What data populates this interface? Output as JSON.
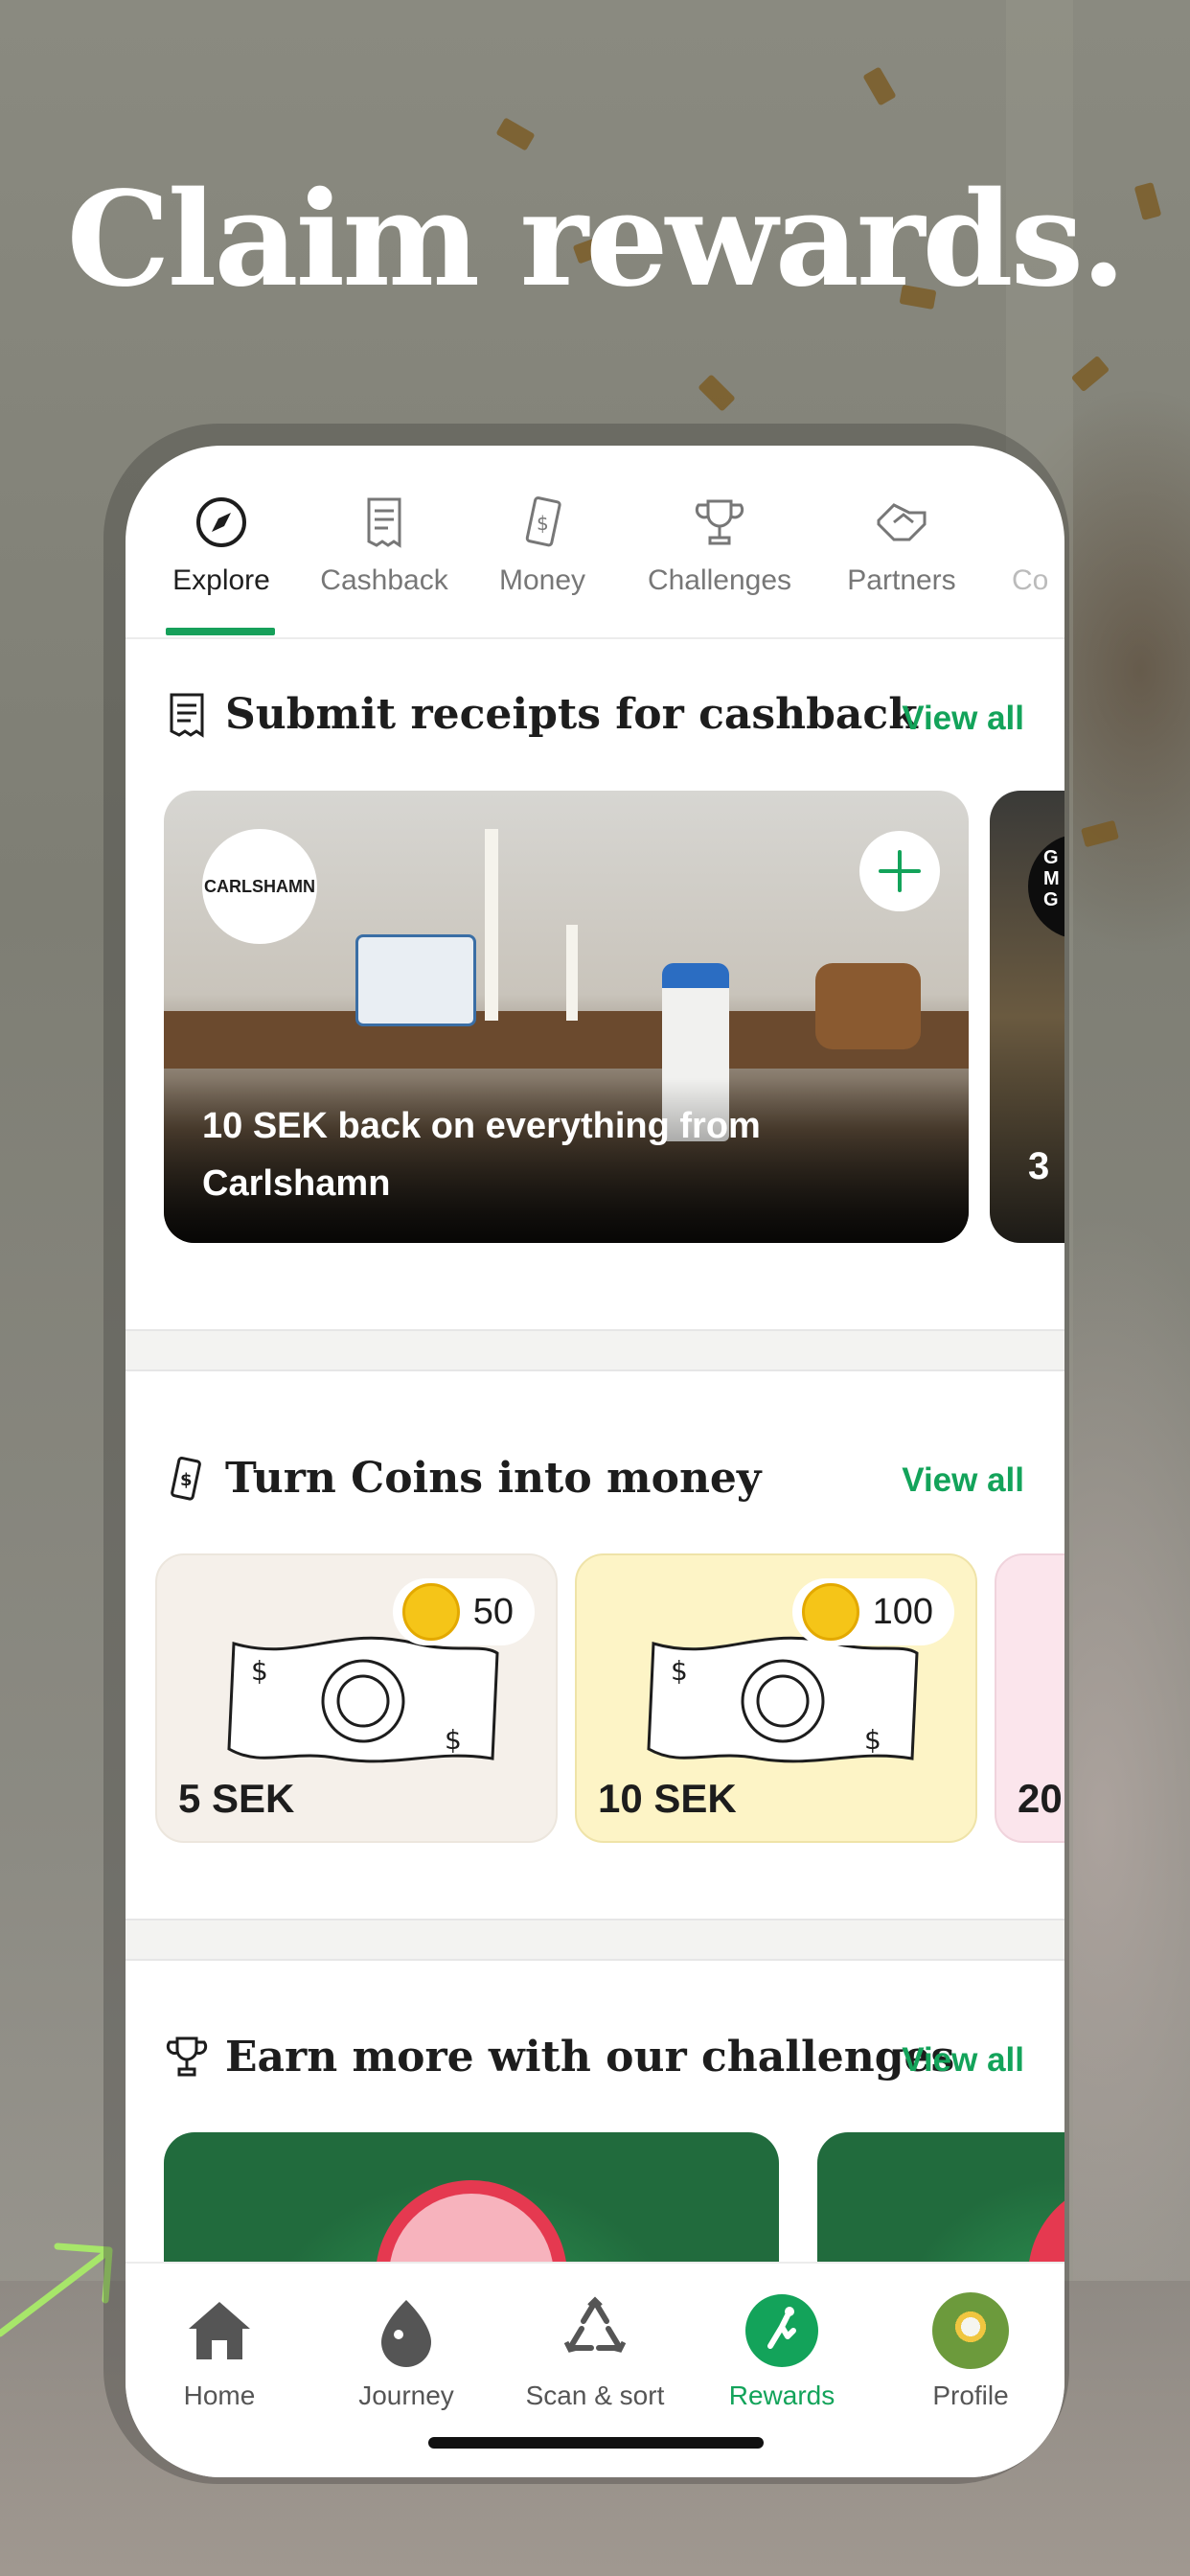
{
  "headline": "Claim rewards.",
  "colors": {
    "accent": "#13a35a",
    "coin": "#f5c518",
    "challenge_green": "#216b3d"
  },
  "tabs": [
    {
      "label": "Explore",
      "icon": "compass-icon",
      "active": true
    },
    {
      "label": "Cashback",
      "icon": "receipt-icon"
    },
    {
      "label": "Money",
      "icon": "banknote-icon"
    },
    {
      "label": "Challenges",
      "icon": "trophy-icon"
    },
    {
      "label": "Partners",
      "icon": "handshake-icon"
    },
    {
      "label": "Co",
      "icon": "partial-icon"
    }
  ],
  "sections": {
    "cashback": {
      "title": "Submit receipts for cashback",
      "view_all": "View all",
      "cards": [
        {
          "brand": "CARLSHAMN",
          "text": "10 SEK back on everything from Carlshamn"
        },
        {
          "brand": "G\nM\nG",
          "text": "3"
        }
      ]
    },
    "money": {
      "title": "Turn Coins into money",
      "view_all": "View all",
      "cards": [
        {
          "coins": "50",
          "amount": "5 SEK"
        },
        {
          "coins": "100",
          "amount": "10 SEK"
        },
        {
          "amount": "20"
        }
      ]
    },
    "challenges": {
      "title": "Earn more with our challenges",
      "view_all": "View all"
    }
  },
  "nav": [
    {
      "label": "Home",
      "icon": "home-icon"
    },
    {
      "label": "Journey",
      "icon": "journey-icon"
    },
    {
      "label": "Scan & sort",
      "icon": "recycle-icon"
    },
    {
      "label": "Rewards",
      "icon": "rewards-icon",
      "active": true
    },
    {
      "label": "Profile",
      "icon": "avatar"
    }
  ]
}
